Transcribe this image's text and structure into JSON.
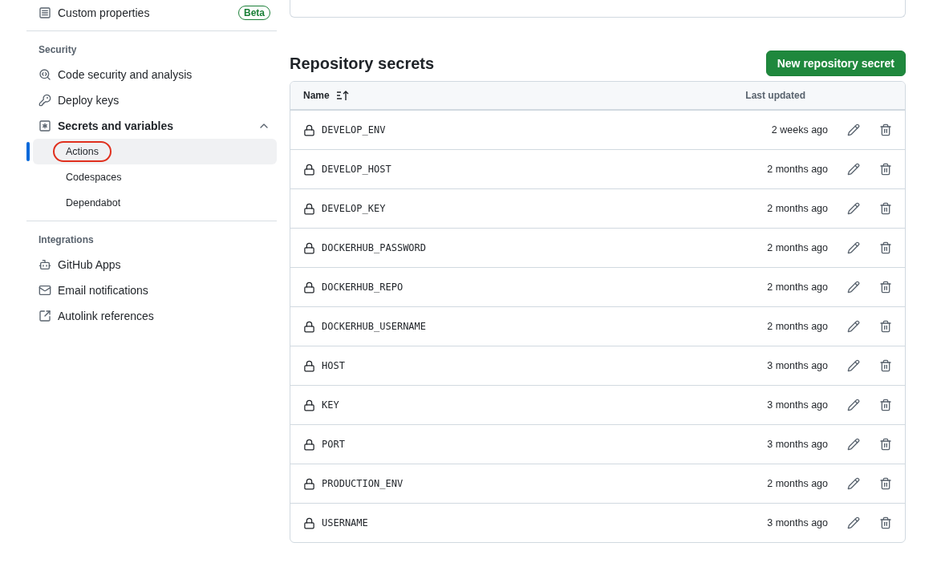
{
  "sidebar": {
    "top_items": [
      {
        "label": "Custom properties",
        "badge": "Beta"
      }
    ],
    "sections": [
      {
        "heading": "Security",
        "items": [
          {
            "label": "Code security and analysis"
          },
          {
            "label": "Deploy keys"
          },
          {
            "label": "Secrets and variables",
            "expanded": true,
            "children": [
              {
                "label": "Actions",
                "selected": true,
                "annotated": true
              },
              {
                "label": "Codespaces",
                "selected": false,
                "annotated": false
              },
              {
                "label": "Dependabot",
                "selected": false,
                "annotated": false
              }
            ]
          }
        ]
      },
      {
        "heading": "Integrations",
        "items": [
          {
            "label": "GitHub Apps"
          },
          {
            "label": "Email notifications"
          },
          {
            "label": "Autolink references"
          }
        ]
      }
    ]
  },
  "secrets": {
    "title": "Repository secrets",
    "new_button": "New repository secret",
    "columns": [
      "Name",
      "Last updated"
    ],
    "rows": [
      {
        "name": "DEVELOP_ENV",
        "updated": "2 weeks ago"
      },
      {
        "name": "DEVELOP_HOST",
        "updated": "2 months ago"
      },
      {
        "name": "DEVELOP_KEY",
        "updated": "2 months ago"
      },
      {
        "name": "DOCKERHUB_PASSWORD",
        "updated": "2 months ago"
      },
      {
        "name": "DOCKERHUB_REPO",
        "updated": "2 months ago"
      },
      {
        "name": "DOCKERHUB_USERNAME",
        "updated": "2 months ago"
      },
      {
        "name": "HOST",
        "updated": "3 months ago"
      },
      {
        "name": "KEY",
        "updated": "3 months ago"
      },
      {
        "name": "PORT",
        "updated": "3 months ago"
      },
      {
        "name": "PRODUCTION_ENV",
        "updated": "2 months ago"
      },
      {
        "name": "USERNAME",
        "updated": "3 months ago"
      }
    ]
  }
}
